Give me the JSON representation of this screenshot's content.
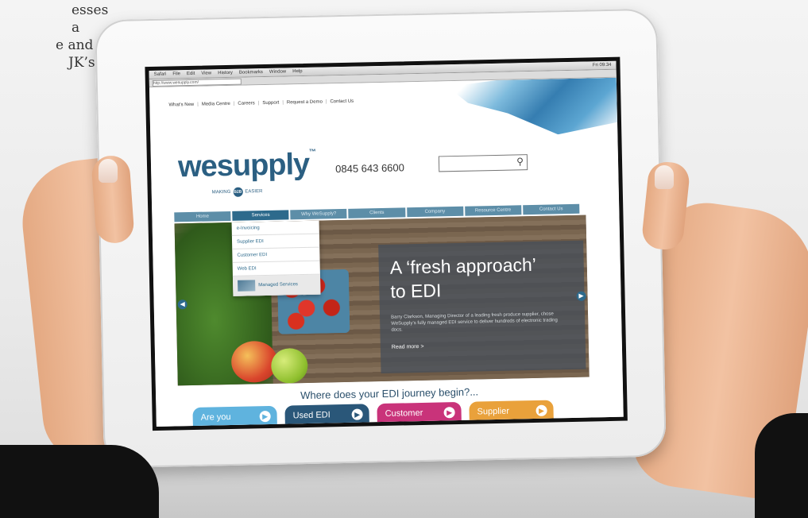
{
  "background_caption": [
    "esses a",
    "e and",
    "JK’s"
  ],
  "os_bar": {
    "menu": [
      "Safari",
      "File",
      "Edit",
      "View",
      "History",
      "Bookmarks",
      "Window",
      "Help"
    ],
    "clock": "Fri 09:34"
  },
  "browser": {
    "url": "http://www.wesupply.com/"
  },
  "site": {
    "topnav": [
      "What's New",
      "Media Centre",
      "Careers",
      "Support",
      "Request a Demo",
      "Contact Us"
    ],
    "logo": "wesupply",
    "logo_tm": "™",
    "tagline_left": "MAKING",
    "tagline_badge": "B2B",
    "tagline_right": "EASIER",
    "phone": "0845 643 6600",
    "search_placeholder": "",
    "mainnav": [
      "Home",
      "Services",
      "Why WeSupply?",
      "Clients",
      "Company",
      "Resource Centre",
      "Contact Us"
    ],
    "mainnav_active_index": 1,
    "dropdown": [
      "e-Invoicing",
      "Supplier EDI",
      "Customer EDI",
      "Web EDI",
      "Managed Services"
    ],
    "hero": {
      "title_line1": "A ‘fresh approach’",
      "title_line2": "to EDI",
      "body": "Barry Clarkson, Managing Director of a leading fresh produce supplier, chose WeSupply’s fully managed EDI service to deliver hundreds of electronic trading docs.",
      "read_more": "Read more >"
    },
    "journey_title": "Where does your EDI journey begin?...",
    "ctas": [
      {
        "label": "Are you",
        "color": "#5fb3de"
      },
      {
        "label": "Used EDI",
        "color": "#2a5779"
      },
      {
        "label": "Customer",
        "color": "#c9337a"
      },
      {
        "label": "Supplier",
        "color": "#e9a13b"
      }
    ]
  },
  "colors": {
    "brand_blue": "#2b5f82",
    "nav_blue": "#5d8ea8",
    "nav_active": "#2d6a8c"
  }
}
